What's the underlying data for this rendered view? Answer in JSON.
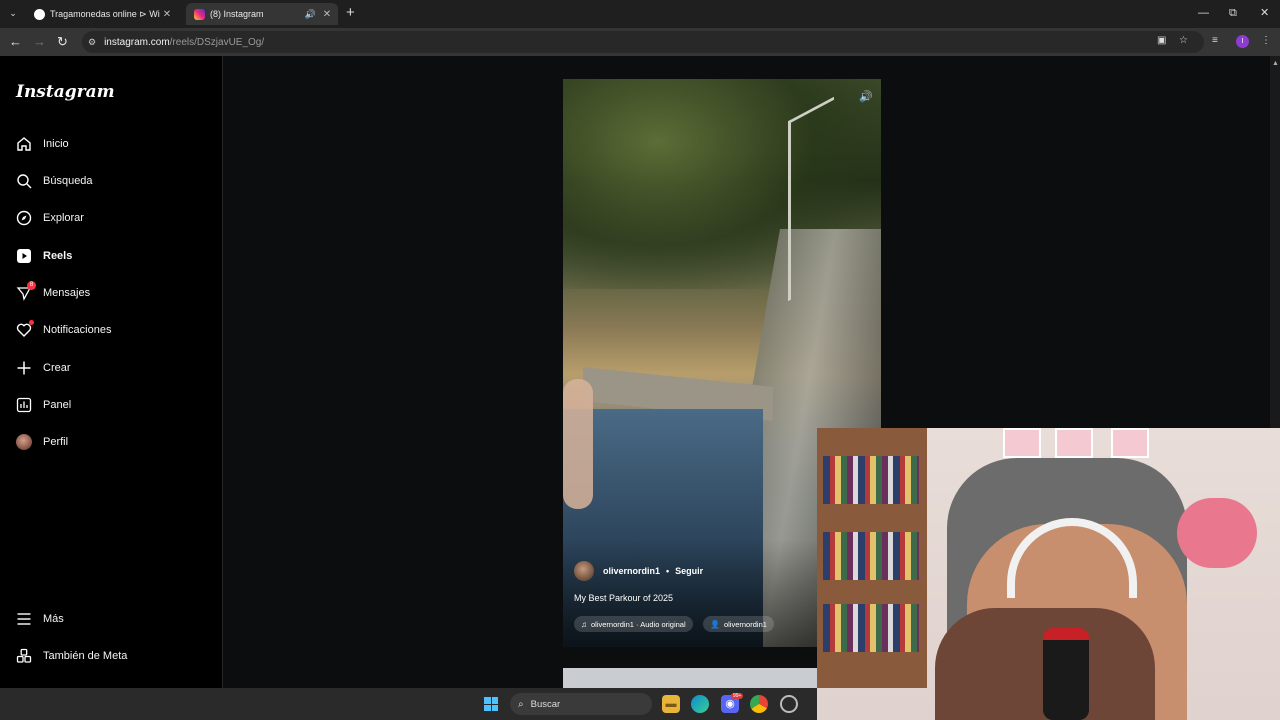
{
  "browser": {
    "tab_menu_icon": "chevron-down-icon",
    "tabs": [
      {
        "title": "Tragamonedas online ⊳ WineB",
        "active": false
      },
      {
        "title": "(8) Instagram",
        "active": true
      }
    ],
    "new_tab_label": "+",
    "window_controls": {
      "minimize": "—",
      "restore": "⧉",
      "close": "✕"
    },
    "url_host": "instagram.com",
    "url_path": "/reels/DSzjavUE_Og/",
    "profile_initial": "I"
  },
  "sidebar": {
    "logo": "Instagram",
    "items": [
      {
        "label": "Inicio",
        "icon": "home-icon"
      },
      {
        "label": "Búsqueda",
        "icon": "search-icon"
      },
      {
        "label": "Explorar",
        "icon": "compass-icon"
      },
      {
        "label": "Reels",
        "icon": "reels-icon"
      },
      {
        "label": "Mensajes",
        "icon": "messenger-icon",
        "badge": "8"
      },
      {
        "label": "Notificaciones",
        "icon": "heart-icon"
      },
      {
        "label": "Crear",
        "icon": "plus-icon"
      },
      {
        "label": "Panel",
        "icon": "chart-icon"
      },
      {
        "label": "Perfil",
        "icon": "avatar"
      }
    ],
    "bottom": [
      {
        "label": "Más",
        "icon": "menu-icon"
      },
      {
        "label": "También de Meta",
        "icon": "meta-icon"
      }
    ]
  },
  "reel": {
    "username": "olivernordin1",
    "separator": "•",
    "follow_label": "Seguir",
    "caption": "My Best Parkour of 2025",
    "audio": "olivernordin1 · Audio original",
    "tagged_user": "olivernordin1"
  },
  "taskbar": {
    "search_placeholder": "Buscar",
    "discord_badge": "99+"
  },
  "colors": {
    "accent_red": "#ff3040",
    "browser_tab_active": "#353535",
    "page_bg": "#0b0d0f"
  }
}
